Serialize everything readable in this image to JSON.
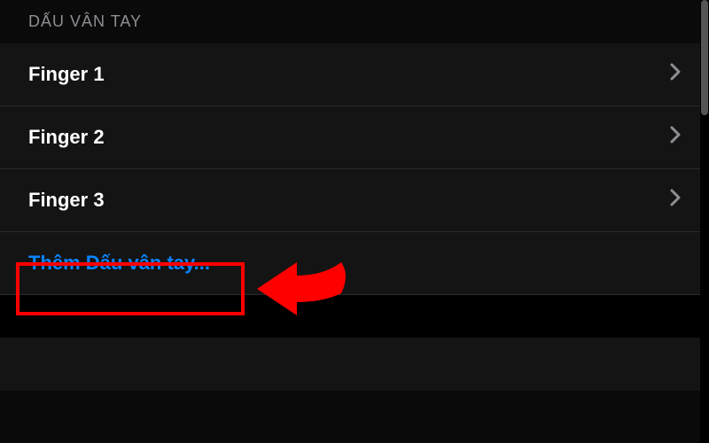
{
  "section": {
    "header": "DẤU VÂN TAY",
    "fingerprints": [
      {
        "label": "Finger 1"
      },
      {
        "label": "Finger 2"
      },
      {
        "label": "Finger 3"
      }
    ],
    "add_label": "Thêm Dấu vân tay..."
  },
  "annotation": {
    "highlight_color": "#ff0000",
    "arrow_color": "#ff0000"
  }
}
